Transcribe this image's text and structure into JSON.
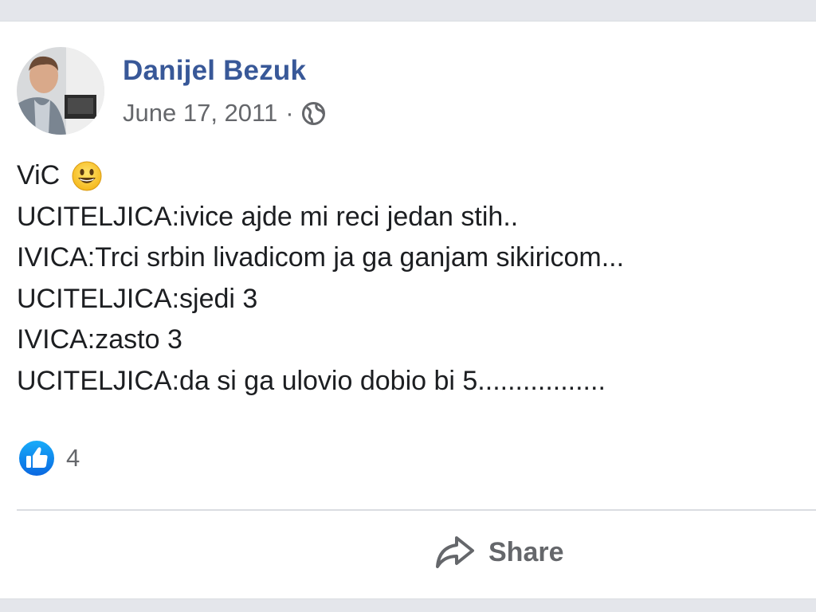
{
  "post": {
    "author": "Danijel Bezuk",
    "date": "June 17, 2011",
    "separator": "·",
    "privacy_icon": "globe-icon",
    "lines": [
      "ViC",
      "UCITELJICA:ivice ajde mi reci jedan stih..",
      "IVICA:Trci srbin livadicom ja ga ganjam sikiricom...",
      "UCITELJICA:sjedi 3",
      "IVICA:zasto 3",
      "UCITELJICA:da si ga ulovio dobio bi 5................."
    ],
    "emoji": "grinning-face-emoji"
  },
  "reactions": {
    "icon": "like-icon",
    "count": "4"
  },
  "actions": {
    "share_label": "Share",
    "share_icon": "share-arrow-icon"
  },
  "colors": {
    "author": "#385898",
    "meta": "#65676b",
    "text": "#1c1e21",
    "like_blue": "#1877f2",
    "background": "#e4e6eb",
    "card": "#ffffff"
  }
}
